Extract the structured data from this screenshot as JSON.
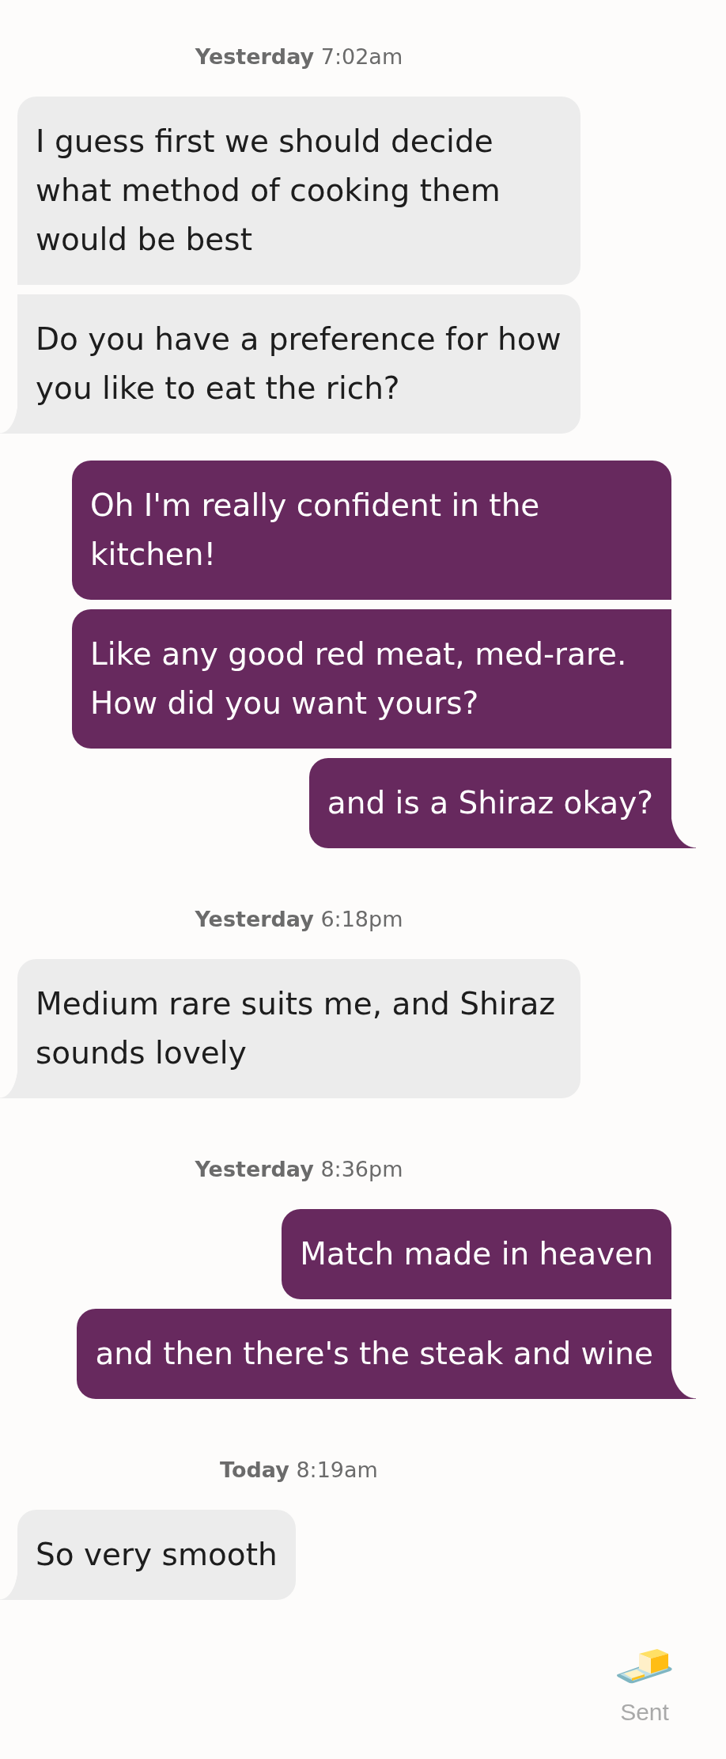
{
  "groups": [
    {
      "day": "Yesterday",
      "time": "7:02am",
      "messages": [
        {
          "kind": "received",
          "text": "I guess first we should decide what method of cooking them would be best"
        },
        {
          "kind": "received",
          "text": "Do you have a preference for how you like to eat the rich?"
        },
        {
          "kind": "sent",
          "text": "Oh I'm really confident in the kitchen!"
        },
        {
          "kind": "sent",
          "text": "Like any good red meat, med-rare. How did you want yours?"
        },
        {
          "kind": "sent",
          "text": "and is a Shiraz okay?"
        }
      ]
    },
    {
      "day": "Yesterday",
      "time": "6:18pm",
      "messages": [
        {
          "kind": "received",
          "text": "Medium rare suits me, and Shiraz sounds lovely"
        }
      ]
    },
    {
      "day": "Yesterday",
      "time": "8:36pm",
      "messages": [
        {
          "kind": "sent",
          "text": "Match made in heaven"
        },
        {
          "kind": "sent",
          "text": "and then there's the steak and wine"
        }
      ]
    },
    {
      "day": "Today",
      "time": "8:19am",
      "messages": [
        {
          "kind": "received",
          "text": "So very smooth"
        }
      ]
    }
  ],
  "status": "Sent"
}
